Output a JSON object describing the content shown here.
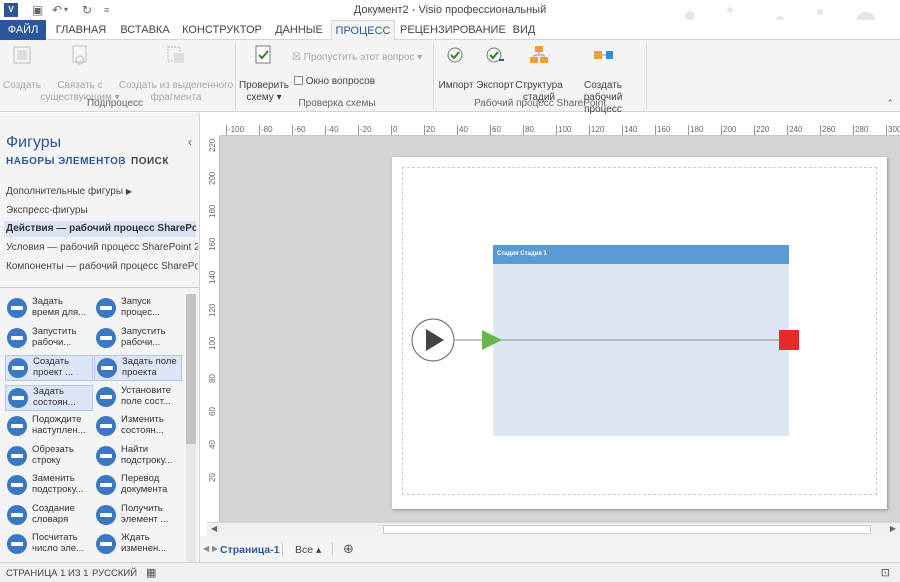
{
  "window": {
    "title": "Документ2 - Visio профессиональный",
    "app_icon": "V"
  },
  "tabs": [
    "ФАЙЛ",
    "ГЛАВНАЯ",
    "ВСТАВКА",
    "КОНСТРУКТОР",
    "ДАННЫЕ",
    "ПРОЦЕСС",
    "РЕЦЕНЗИРОВАНИЕ",
    "ВИД"
  ],
  "active_tab": "ПРОЦЕСС",
  "ribbon": {
    "subprocess": {
      "create": "Создать",
      "link1": "Связать с",
      "link2": "существующим",
      "from1": "Создать из выделенного",
      "from2": "фрагмента",
      "label": "Подпроцесс"
    },
    "check": {
      "check1": "Проверить",
      "check2": "схему",
      "skip": "Пропустить этот вопрос",
      "issues": "Окно вопросов",
      "label": "Проверка схемы"
    },
    "sharepoint": {
      "import": "Импорт",
      "export": "Экспорт",
      "stages1": "Структура",
      "stages2": "стадий",
      "create1": "Создать рабочий",
      "create2": "процесс",
      "label": "Рабочий процесс SharePoint"
    }
  },
  "shapes_pane": {
    "title": "Фигуры",
    "nav_sets": "НАБОРЫ ЭЛЕМЕНТОВ",
    "nav_search": "ПОИСК",
    "stencils": [
      "Дополнительные фигуры",
      "Экспресс-фигуры",
      "Действия — рабочий процесс SharePoi...",
      "Условия — рабочий процесс SharePoint 2...",
      "Компоненты — рабочий процесс SharePo..."
    ],
    "selected_stencil": 2,
    "masters": [
      [
        "Задать",
        "время для..."
      ],
      [
        "Запуск",
        "процес..."
      ],
      [
        "Запустить",
        "рабочи..."
      ],
      [
        "Запустить",
        "рабочи..."
      ],
      [
        "Создать",
        "проект ..."
      ],
      [
        "Задать поле",
        "проекта"
      ],
      [
        "Задать",
        "состоян..."
      ],
      [
        "Установите",
        "поле сост..."
      ],
      [
        "Подождите",
        "наступлен..."
      ],
      [
        "Изменить",
        "состоян..."
      ],
      [
        "Обрезать",
        "строку"
      ],
      [
        "Найти",
        "подстроку..."
      ],
      [
        "Заменить",
        "подстроку..."
      ],
      [
        "Перевод",
        "документа"
      ],
      [
        "Создание",
        "словаря"
      ],
      [
        "Получить",
        "элемент ..."
      ],
      [
        "Посчитать",
        "число эле..."
      ],
      [
        "Ждать",
        "изменен..."
      ]
    ],
    "selected_masters": [
      4,
      5,
      6
    ]
  },
  "ruler_h": [
    "-100",
    "-80",
    "-60",
    "-40",
    "-20",
    "0",
    "20",
    "40",
    "60",
    "80",
    "100",
    "120",
    "140",
    "160",
    "180",
    "200",
    "220",
    "240",
    "260",
    "280",
    "300"
  ],
  "ruler_v": [
    "220",
    "200",
    "180",
    "160",
    "140",
    "120",
    "100",
    "80",
    "60",
    "40",
    "20"
  ],
  "diagram": {
    "lane_header": "Стадия   Стадия 1"
  },
  "page_tabs": {
    "page1": "Страница-1",
    "all": "Все ▴",
    "add": "⊕"
  },
  "status": {
    "page": "СТРАНИЦА 1 ИЗ 1",
    "lang": "РУССКИЙ"
  },
  "colors": {
    "accent": "#2b579a",
    "lane_header": "#5b9bd5",
    "lane_body": "#dde7f3",
    "start_green": "#6ab64a",
    "end_red": "#e8282a"
  }
}
